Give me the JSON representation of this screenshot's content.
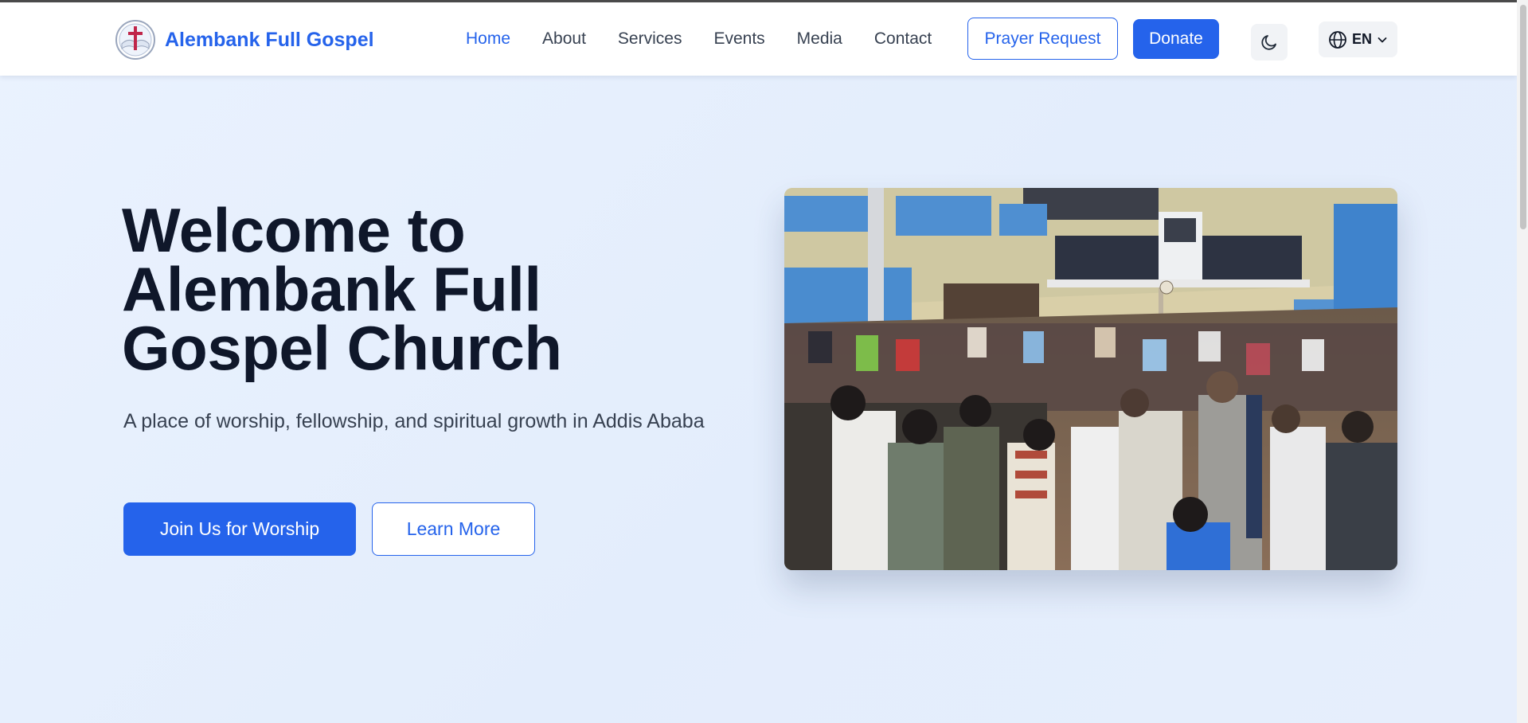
{
  "brand": {
    "name": "Alembank Full Gospel",
    "logo_icon": "church-cross-logo"
  },
  "nav": {
    "items": [
      {
        "label": "Home",
        "active": true
      },
      {
        "label": "About",
        "active": false
      },
      {
        "label": "Services",
        "active": false
      },
      {
        "label": "Events",
        "active": false
      },
      {
        "label": "Media",
        "active": false
      },
      {
        "label": "Contact",
        "active": false
      }
    ],
    "prayer_label": "Prayer Request",
    "donate_label": "Donate",
    "theme_icon": "moon-icon",
    "language": {
      "code": "EN",
      "icon": "globe-icon",
      "chevron": "chevron-down-icon"
    }
  },
  "hero": {
    "title_lines": [
      "Welcome to",
      "Alembank Full",
      "Gospel Church"
    ],
    "subtitle": "A place of worship, fellowship, and spiritual growth in Addis Ababa",
    "primary_cta": "Join Us for Worship",
    "secondary_cta": "Learn More",
    "image_subject": "congregation-in-prayer-photo"
  },
  "colors": {
    "accent": "#2563eb",
    "heading": "#0f172a",
    "body_text": "#374151",
    "background": "#e6eefc"
  }
}
